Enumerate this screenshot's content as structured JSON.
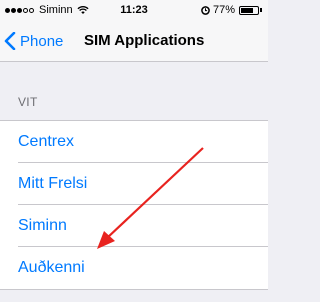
{
  "status_bar": {
    "carrier": "Siminn",
    "time": "11:23",
    "battery": "77%",
    "battery_level": 0.77,
    "signal_bars": 3,
    "signal_total": 5
  },
  "nav": {
    "back_label": "Phone",
    "title": "SIM Applications"
  },
  "section": {
    "header": "VIT",
    "items": [
      {
        "label": "Centrex"
      },
      {
        "label": "Mitt Frelsi"
      },
      {
        "label": "Siminn"
      },
      {
        "label": "Auðkenni"
      }
    ]
  },
  "colors": {
    "accent": "#007aff",
    "annotation_arrow": "#e8231f",
    "background": "#efeff4"
  },
  "icons": {
    "back": "chevron-left-icon",
    "wifi": "wifi-icon",
    "alarm": "alarm-icon",
    "battery": "battery-icon",
    "signal": "signal-dots-icon"
  }
}
